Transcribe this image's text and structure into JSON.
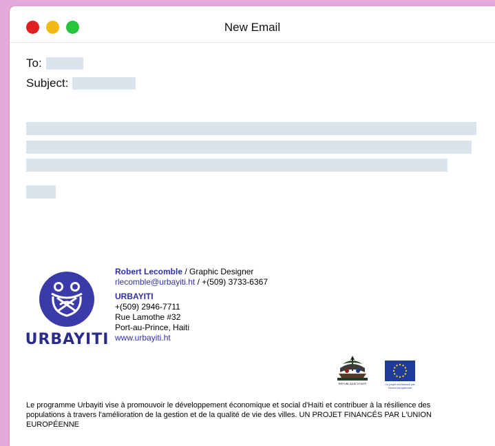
{
  "window": {
    "title": "New Email",
    "controls": [
      "close",
      "minimize",
      "zoom"
    ]
  },
  "compose": {
    "to_label": "To:",
    "to_value": "",
    "subject_label": "Subject:",
    "subject_value": ""
  },
  "signature": {
    "name": "Robert Lecomble",
    "separator": " / ",
    "role": "Graphic Designer",
    "email": "rlecomble@urbayiti.ht",
    "contact_separator": " / ",
    "phone": "+(509) 3733-6367",
    "org_name": "URBAYITI",
    "org_phone": "+(509) 2946-7711",
    "address_line1": "Rue Lamothe #32",
    "address_line2": "Port-au-Prince, Haiti",
    "website": "www.urbayiti.ht",
    "logo_wordmark": "URBAYITI",
    "haiti_label": "RÉPUBLIQUE D'HAÏTI",
    "eu_label": "Ce projet est financé par l'Union européenne"
  },
  "footer": {
    "text": "Le programme Urbayiti vise à promouvoir le développement économique et social d'Haïti et contribuer à la résilience des populations à travers l'amélioration de la gestion et de la qualité de vie des villes. UN PROJET FINANCÉS PAR L'UNION EUROPÉENNE"
  },
  "colors": {
    "accent": "#3a3aa8",
    "placeholder": "#dbe3ec",
    "background": "#e6a9db"
  }
}
